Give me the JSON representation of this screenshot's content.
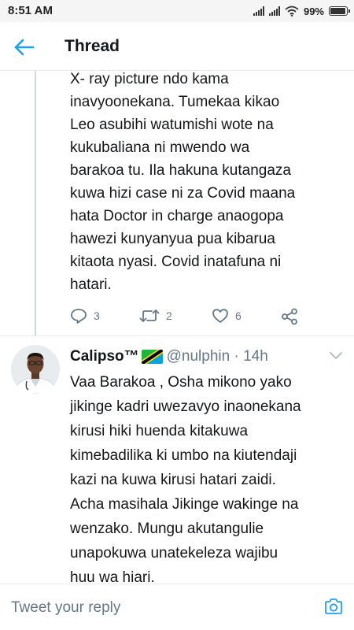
{
  "status_bar": {
    "time": "8:51 AM",
    "battery_pct": "99%",
    "battery_level": 0.99
  },
  "header": {
    "title": "Thread",
    "back_icon": "arrow-left-icon",
    "accent_color": "#1da1f2"
  },
  "tweet1": {
    "text": "X- ray picture ndo kama\ninavyoonekana. Tumekaa kikao\nLeo asubihi watumishi wote na\nkukubaliana ni mwendo wa\nbarakoa tu. Ila hakuna kutangaza\nkuwa hizi case ni za Covid maana\nhata Doctor in charge anaogopa\nhawezi kunyanyua pua kibarua\nkitaota nyasi. Covid inatafuna ni\nhatari.",
    "replies": "3",
    "retweets": "2",
    "likes": "6"
  },
  "tweet2": {
    "name": "Calipso™",
    "handle": "@nulphin · 14h",
    "text": "Vaa Barakoa , Osha mikono yako\njikinge kadri uwezavyo inaonekana\nkirusi hiki huenda kitakuwa\nkimebadilika ki umbo na kiutendaji\nkazi na kuwa kirusi hatari zaidi.\nAcha masihala Jikinge wakinge na\nwenzako. Mungu akutangulie\nunapokuwa unatekeleza wajibu\nhuu wa hiari."
  },
  "reply_bar": {
    "placeholder": "Tweet your reply",
    "camera_icon": "camera-icon"
  },
  "colors": {
    "text_primary": "#14171a",
    "text_secondary": "#657786",
    "accent": "#1da1f2",
    "divider": "#e6ecf0"
  }
}
